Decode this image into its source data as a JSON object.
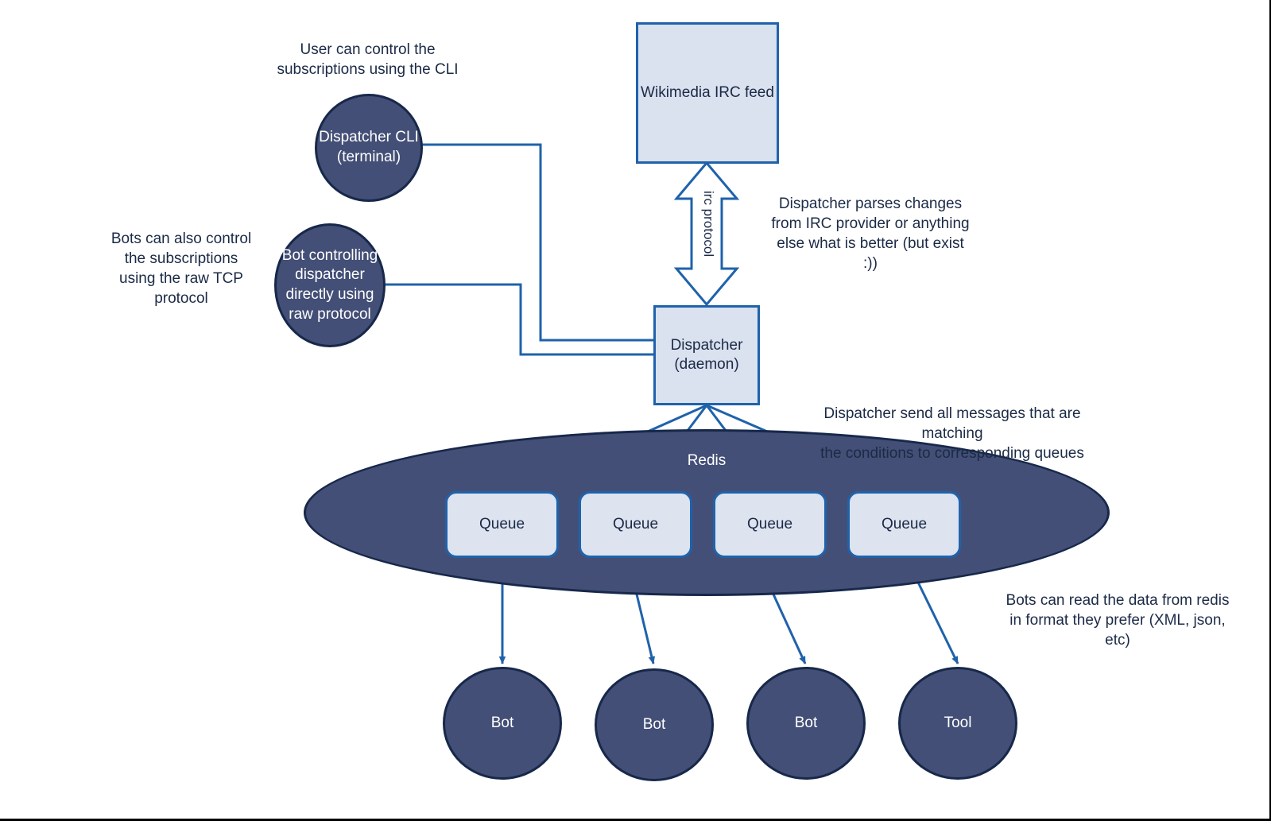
{
  "diagram": {
    "title": "Wikimedia IRC dispatcher architecture",
    "colors": {
      "box_fill": "#dae1ef",
      "box_stroke": "#1f62ab",
      "circle_fill": "#434f76",
      "circle_stroke": "#17284a",
      "text_dark": "#1b2a46",
      "text_light": "#ffffff",
      "connector": "#1f62ab"
    }
  },
  "nodes": {
    "irc_feed": {
      "label": "Wikimedia IRC feed",
      "shape": "rectangle"
    },
    "dispatcher_cli": {
      "label": "Dispatcher CLI\n(terminal)",
      "shape": "circle"
    },
    "bot_controller": {
      "label": "Bot controlling\ndispatcher\ndirectly using\nraw protocol",
      "shape": "circle"
    },
    "dispatcher_daemon": {
      "label": "Dispatcher\n(daemon)",
      "shape": "rectangle"
    },
    "redis": {
      "label": "Redis",
      "shape": "ellipse"
    }
  },
  "queues": [
    {
      "label": "Queue"
    },
    {
      "label": "Queue"
    },
    {
      "label": "Queue"
    },
    {
      "label": "Queue"
    }
  ],
  "consumers": [
    {
      "label": "Bot"
    },
    {
      "label": "Bot"
    },
    {
      "label": "Bot"
    },
    {
      "label": "Tool"
    }
  ],
  "edge_labels": {
    "irc_protocol": "irc protocol"
  },
  "notes": {
    "cli_note": "User can control the\nsubscriptions using the CLI",
    "bots_tcp_note": "Bots can also control\nthe subscriptions\nusing the raw TCP\nprotocol",
    "dispatcher_parse_note": "Dispatcher parses changes\nfrom IRC provider or anything\nelse what is better (but exist\n:))",
    "dispatcher_send_note": "Dispatcher send all messages that are matching\nthe conditions to corresponding queues",
    "bots_read_note": "Bots can read the data from redis\nin format they prefer (XML, json,\netc)"
  }
}
